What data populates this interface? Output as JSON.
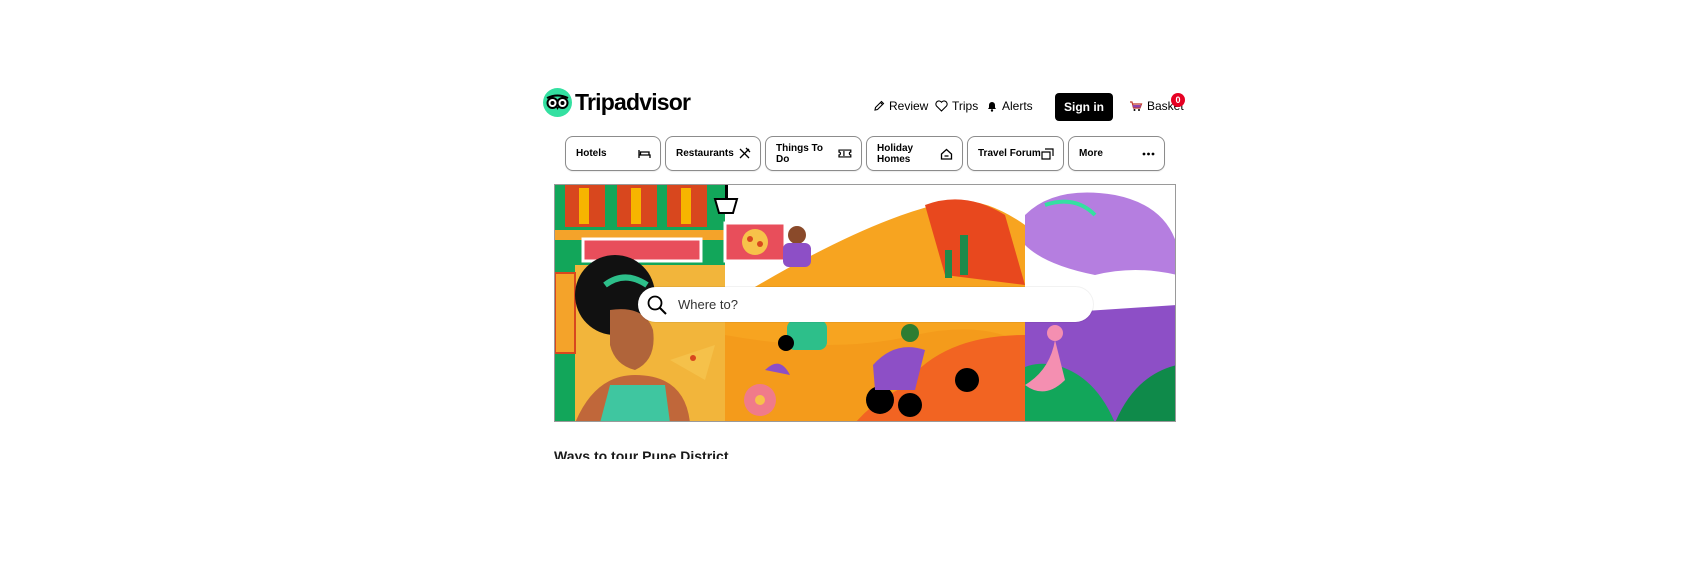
{
  "header": {
    "logo_text": "Tripadvisor",
    "review_label": "Review",
    "trips_label": "Trips",
    "alerts_label": "Alerts",
    "signin_label": "Sign in",
    "basket_label": "Basket",
    "basket_count": "0"
  },
  "nav": {
    "items": [
      {
        "label": "Hotels",
        "icon": "bed-icon"
      },
      {
        "label": "Restaurants",
        "icon": "cutlery-icon"
      },
      {
        "label": "Things To Do",
        "icon": "ticket-icon"
      },
      {
        "label": "Holiday Homes",
        "icon": "home-icon"
      },
      {
        "label": "Travel Forum",
        "icon": "chat-icon"
      },
      {
        "label": "More",
        "icon": "more-dots-icon"
      }
    ]
  },
  "hero": {
    "search_placeholder": "Where to?"
  },
  "section": {
    "title": "Ways to tour Pune District"
  },
  "colors": {
    "brand": "#34e0a1",
    "signin_bg": "#000000",
    "badge": "#e60023"
  }
}
